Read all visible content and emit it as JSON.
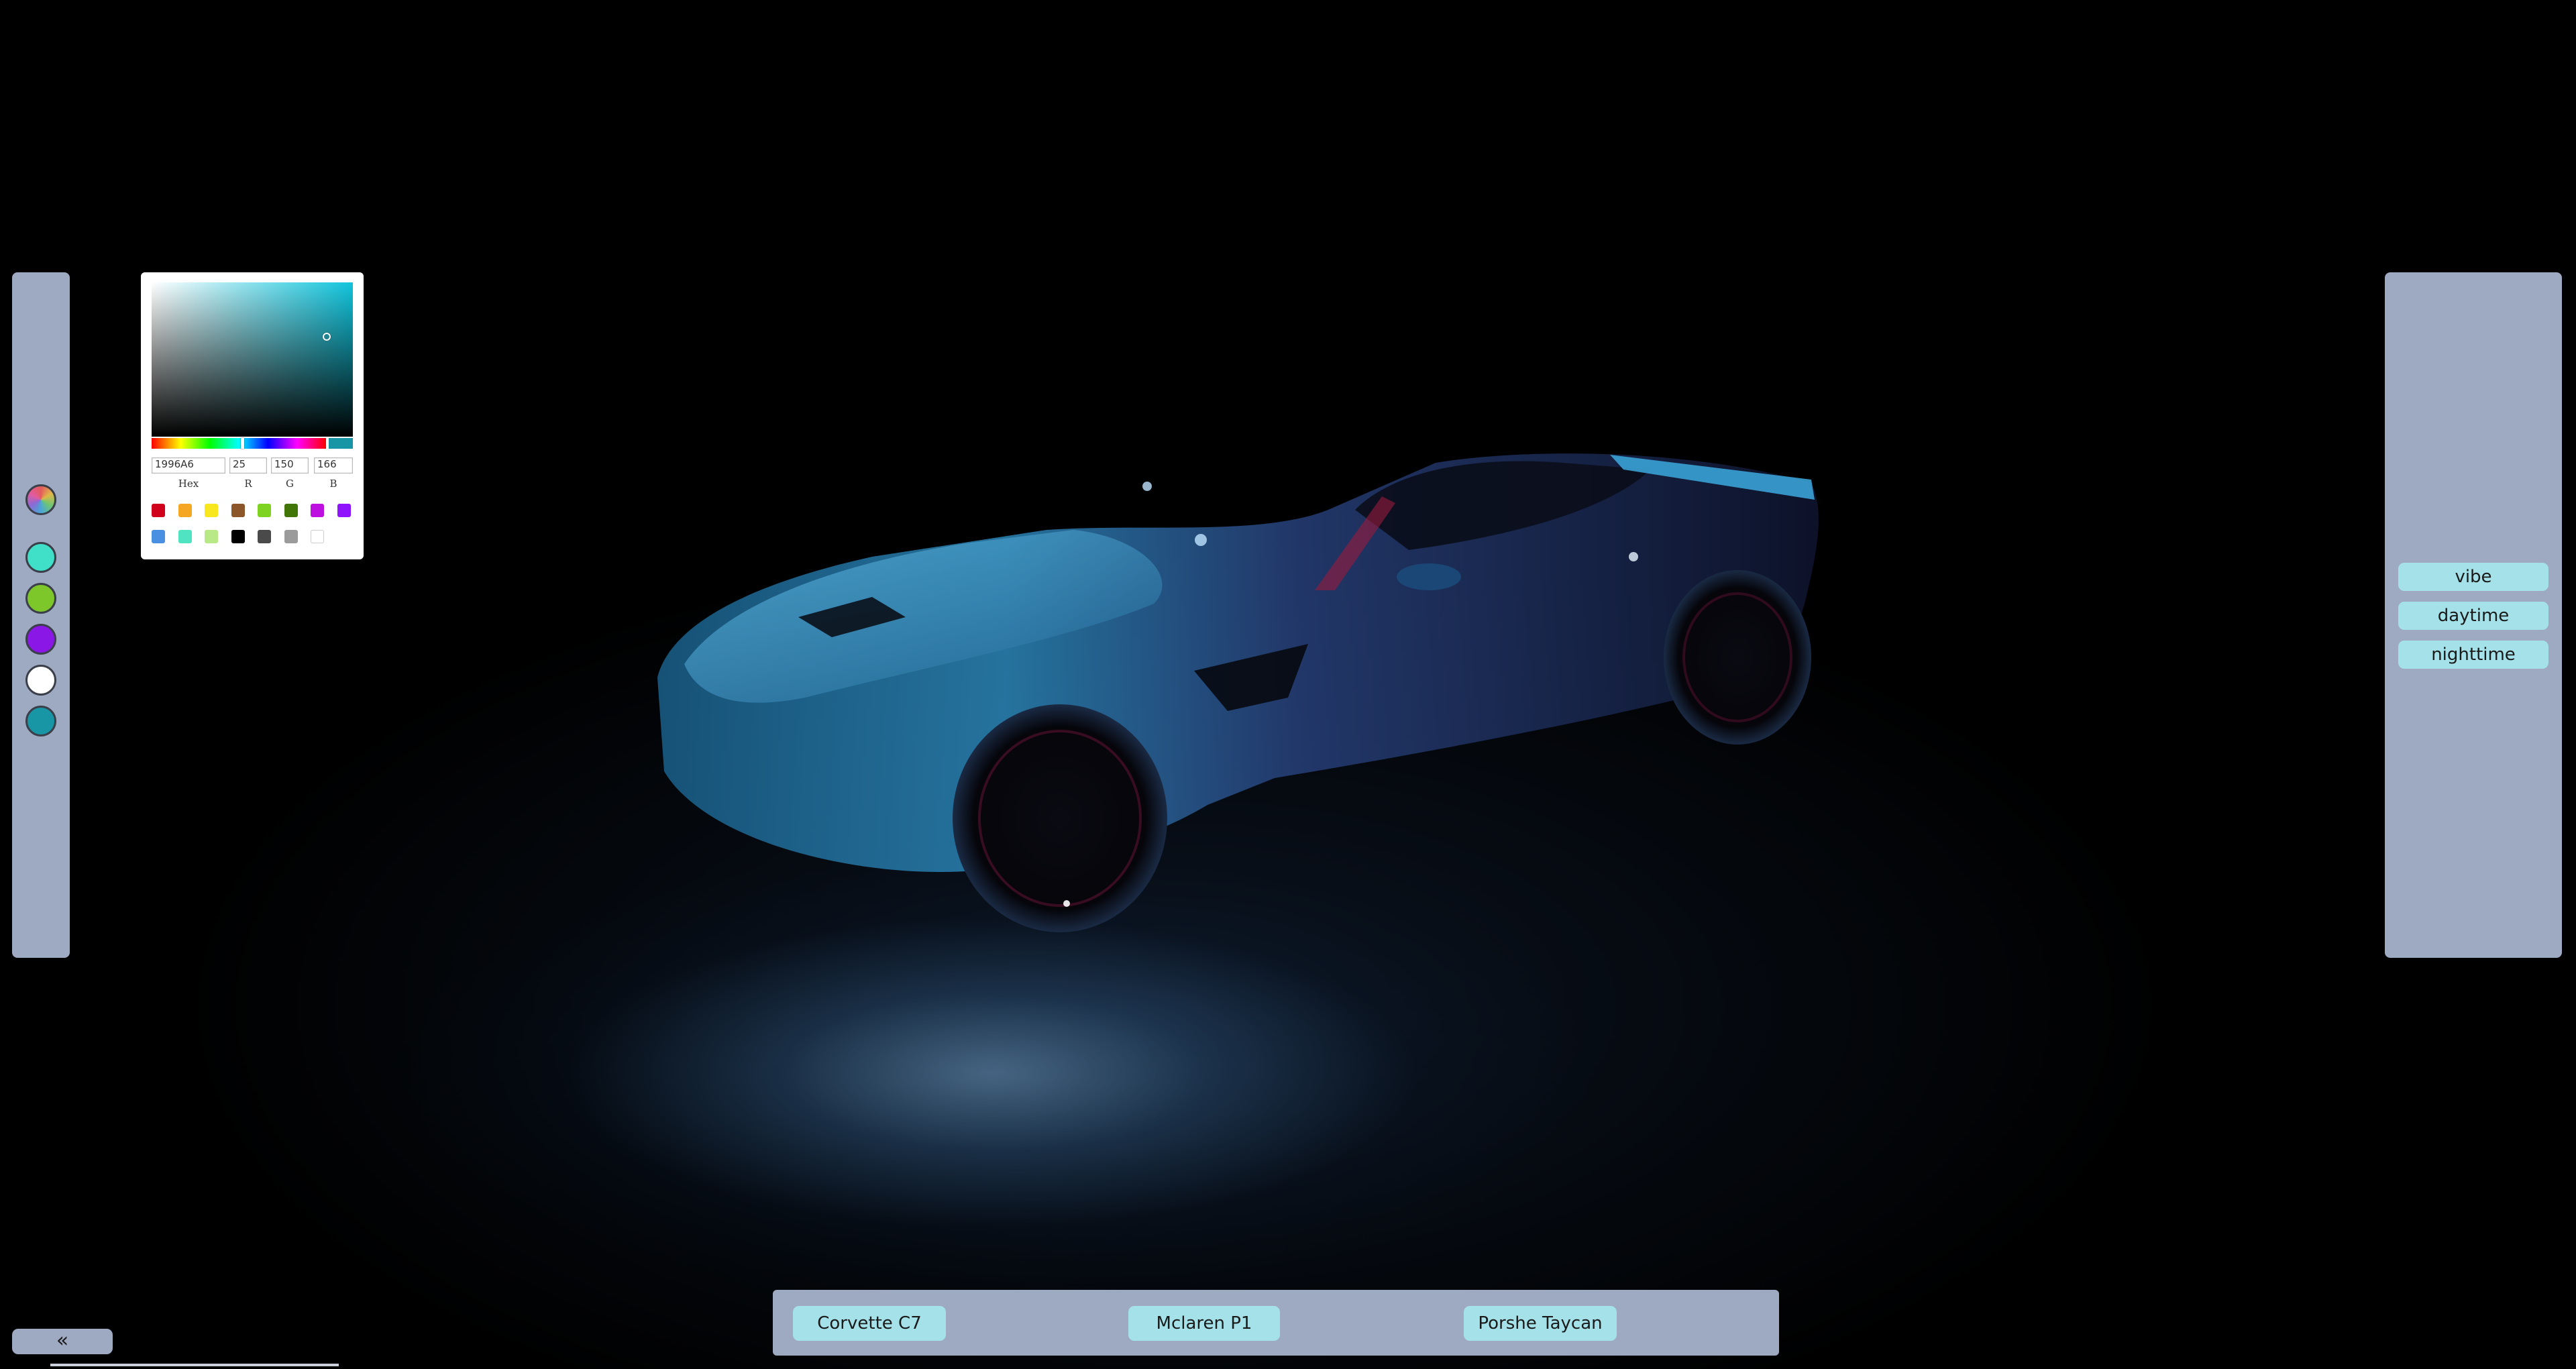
{
  "left_panel": {
    "swatches": [
      {
        "name": "custom-color",
        "color": "rainbow"
      },
      {
        "name": "turquoise",
        "color": "#40e0c8"
      },
      {
        "name": "green",
        "color": "#7ec72a"
      },
      {
        "name": "purple",
        "color": "#8a17e6"
      },
      {
        "name": "white",
        "color": "#ffffff"
      },
      {
        "name": "teal",
        "color": "#1996a6"
      }
    ]
  },
  "color_picker": {
    "hex_value": "1996A6",
    "r_value": "25",
    "g_value": "150",
    "b_value": "166",
    "hex_label": "Hex",
    "r_label": "R",
    "g_label": "G",
    "b_label": "B",
    "current_color": "#1996a6",
    "presets_row1": [
      "#d0021b",
      "#f5a623",
      "#f8e71c",
      "#8b572a",
      "#7ed321",
      "#417505",
      "#bd10e0",
      "#9013fe"
    ],
    "presets_row2": [
      "#4a90e2",
      "#50e3c2",
      "#b8e986",
      "#000000",
      "#4a4a4a",
      "#9b9b9b",
      "#ffffff"
    ]
  },
  "right_panel": {
    "buttons": [
      "vibe",
      "daytime",
      "nighttime"
    ]
  },
  "bottom_panel": {
    "cars": [
      "Corvette C7",
      "Mclaren P1",
      "Porshe Taycan"
    ]
  },
  "collapse_label": "«",
  "colors": {
    "panel": "#9ea9c2",
    "button": "#a4e1e8"
  }
}
